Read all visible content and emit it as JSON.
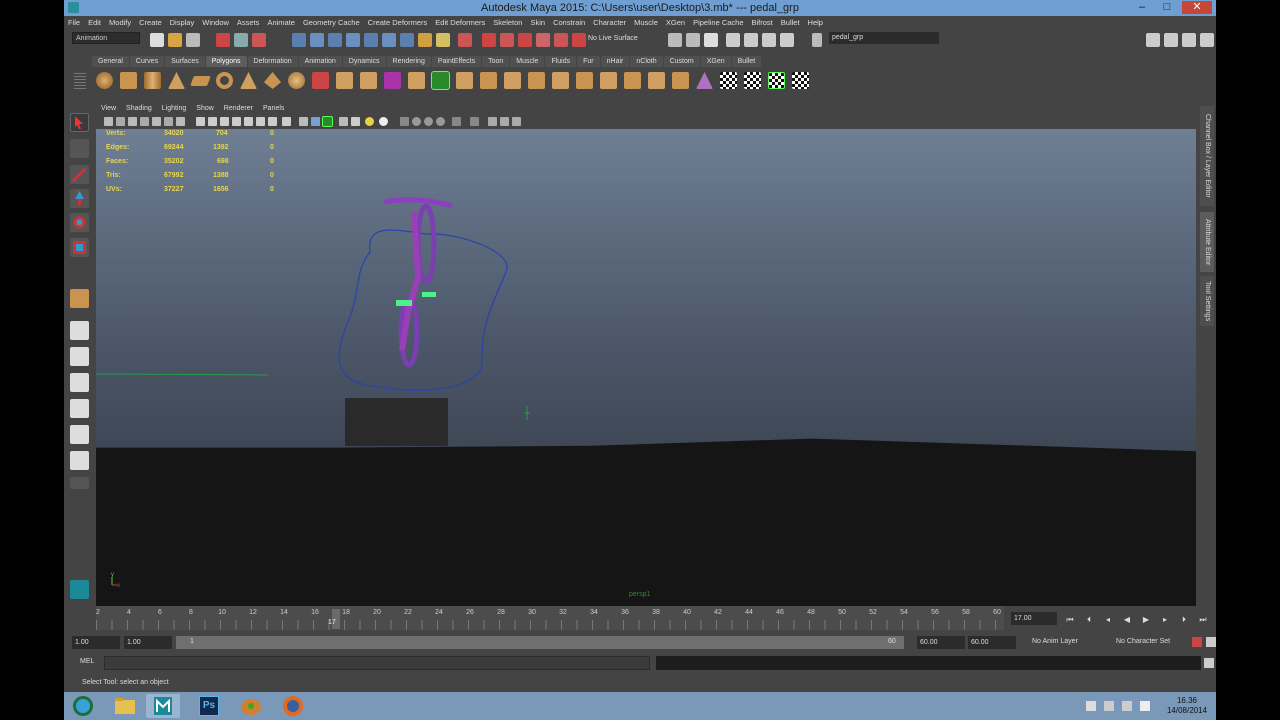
{
  "window": {
    "title": "Autodesk Maya 2015: C:\\Users\\user\\Desktop\\3.mb*   ---   pedal_grp",
    "min_label": "–",
    "max_label": "□",
    "close_label": "✕"
  },
  "menubar": {
    "items": [
      "File",
      "Edit",
      "Modify",
      "Create",
      "Display",
      "Window",
      "Assets",
      "Animate",
      "Geometry Cache",
      "Create Deformers",
      "Edit Deformers",
      "Skeleton",
      "Skin",
      "Constrain",
      "Character",
      "Muscle",
      "XGen",
      "Pipeline Cache",
      "Bifrost",
      "Bullet",
      "Help"
    ]
  },
  "statusline": {
    "menu_set": "Animation",
    "live_surface": "No Live Surface",
    "selection_field": "pedal_grp"
  },
  "shelf": {
    "tabs": [
      "General",
      "Curves",
      "Surfaces",
      "Polygons",
      "Deformation",
      "Animation",
      "Dynamics",
      "Rendering",
      "PaintEffects",
      "Toon",
      "Muscle",
      "Fluids",
      "Fur",
      "nHair",
      "nCloth",
      "Custom",
      "XGen",
      "Bullet"
    ],
    "active_tab": "Polygons"
  },
  "viewport": {
    "menu": [
      "View",
      "Shading",
      "Lighting",
      "Show",
      "Renderer",
      "Panels"
    ],
    "camera_label": "persp1",
    "hud": {
      "rows": [
        {
          "label": "Verts:",
          "total": "34020",
          "selected": "704",
          "third": "0"
        },
        {
          "label": "Edges:",
          "total": "69244",
          "selected": "1392",
          "third": "0"
        },
        {
          "label": "Faces:",
          "total": "35202",
          "selected": "698",
          "third": "0"
        },
        {
          "label": "Tris:",
          "total": "67992",
          "selected": "1388",
          "third": "0"
        },
        {
          "label": "UVs:",
          "total": "37227",
          "selected": "1656",
          "third": "0"
        }
      ]
    },
    "axis": {
      "y": "y",
      "x": "x"
    }
  },
  "right_panel": {
    "tabs": [
      "Channel Box / Layer Editor",
      "Attribute Editor",
      "Tool Settings"
    ]
  },
  "timeline": {
    "ticks": [
      "2",
      "4",
      "6",
      "8",
      "10",
      "12",
      "14",
      "16",
      "18",
      "20",
      "22",
      "24",
      "26",
      "28",
      "30",
      "32",
      "34",
      "36",
      "38",
      "40",
      "42",
      "44",
      "46",
      "48",
      "50",
      "52",
      "54",
      "56",
      "58",
      "60"
    ],
    "current_frame": "17",
    "frame_field": "17.00"
  },
  "range": {
    "start": "1.00",
    "start2": "1.00",
    "slider_left": "1",
    "slider_right": "60",
    "end": "60.00",
    "end2": "60.00",
    "anim_layer": "No Anim Layer",
    "character_set": "No Character Set"
  },
  "command": {
    "mel_label": "MEL",
    "help": "Select Tool: select an object"
  },
  "taskbar": {
    "time": "16.36",
    "date": "14/08/2014",
    "ps_label": "Ps"
  }
}
